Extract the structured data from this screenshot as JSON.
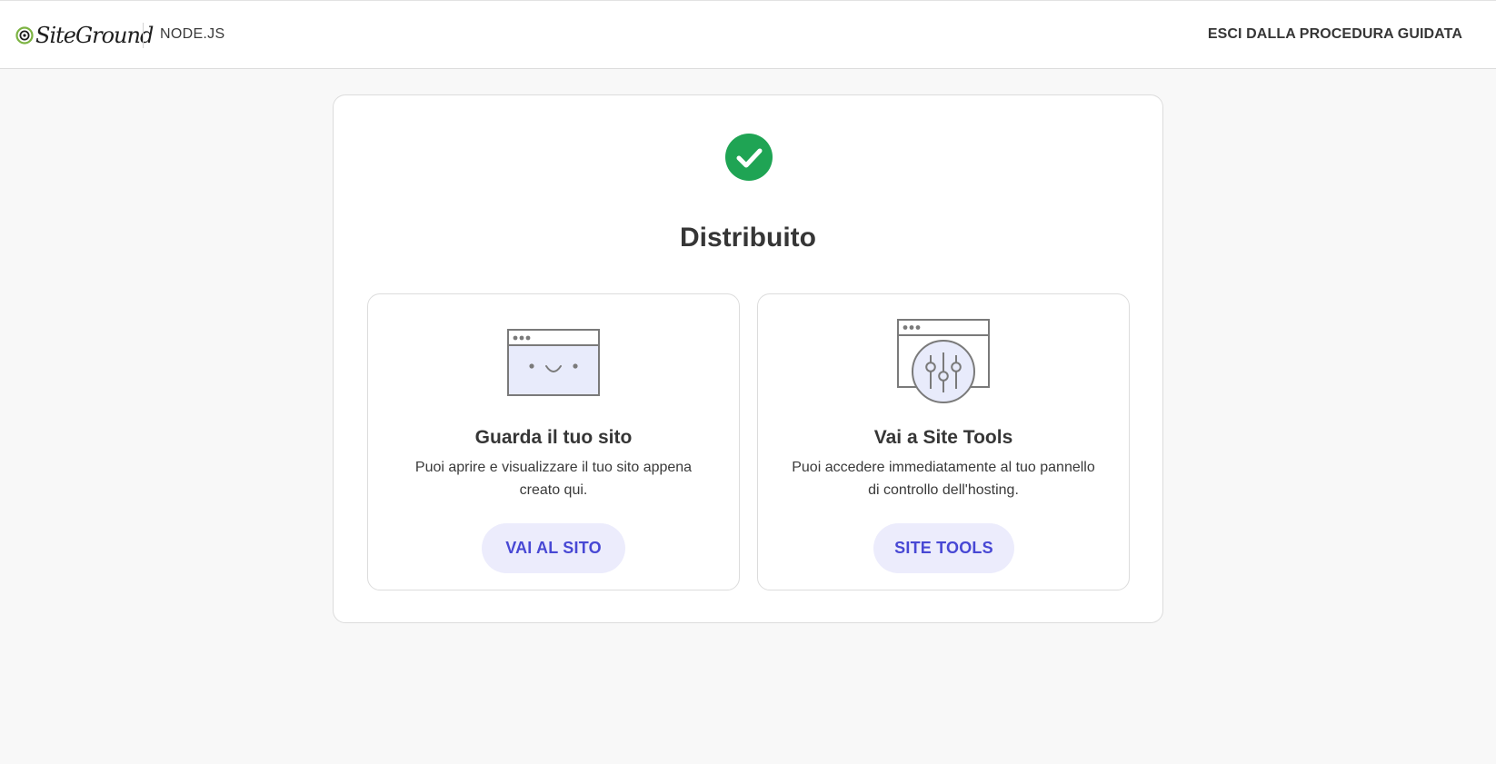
{
  "header": {
    "logo_text": "SiteGround",
    "product": "NODE.JS",
    "exit_label": "ESCI DALLA PROCEDURA GUIDATA"
  },
  "panel": {
    "title": "Distribuito",
    "status_icon": "check-circle-icon",
    "status_color": "#1fa454"
  },
  "cards": [
    {
      "icon": "smiling-browser-icon",
      "title": "Guarda il tuo sito",
      "description": "Puoi aprire e visualizzare il tuo sito appena creato qui.",
      "button_label": "VAI AL SITO"
    },
    {
      "icon": "browser-settings-sliders-icon",
      "title": "Vai a Site Tools",
      "description": "Puoi accedere immediatamente al tuo pannello di controllo dell'hosting.",
      "button_label": "SITE TOOLS"
    }
  ],
  "colors": {
    "accent": "#4848d4",
    "button_bg": "#ececfc",
    "brand_green": "#7cb342",
    "background": "#f8f8f8"
  }
}
